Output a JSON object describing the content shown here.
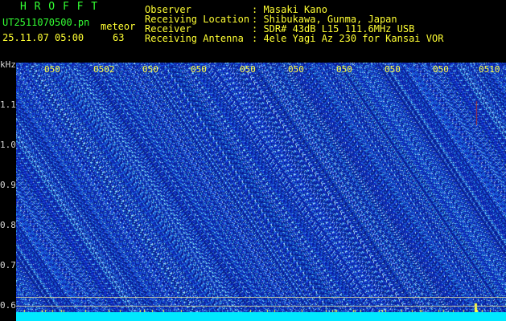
{
  "header": {
    "app_title": "H R O F F T",
    "file_name": "UT2511070500.pn",
    "mode_label": "meteor",
    "datetime": "25.11.07 05:00",
    "count": "63",
    "info_labels": [
      "Observer",
      "Receiving Location",
      "Receiver",
      "Receiving Antenna"
    ],
    "info_values": [
      ": Masaki Kano",
      ": Shibukawa, Gunma, Japan",
      ": SDR# 43dB L15 111.6MHz USB",
      ": 4ele Yagi Az 230 for Kansai VOR"
    ]
  },
  "y_axis": {
    "unit": "kHz",
    "ticks": [
      "1.1",
      "1.0",
      "0.9",
      "0.8",
      "0.7",
      "0.6"
    ]
  },
  "x_axis": {
    "ticks": [
      "050",
      "0502",
      "050",
      "050",
      "050",
      "050",
      "050",
      "050",
      "050",
      "0510"
    ]
  },
  "colors": {
    "background": "#000000",
    "title": "#33ff33",
    "text": "#ffff33",
    "noise_base": "#1a2fb0",
    "noise_speckle": "#7fd0ff",
    "baseband": "#00e8ff"
  }
}
